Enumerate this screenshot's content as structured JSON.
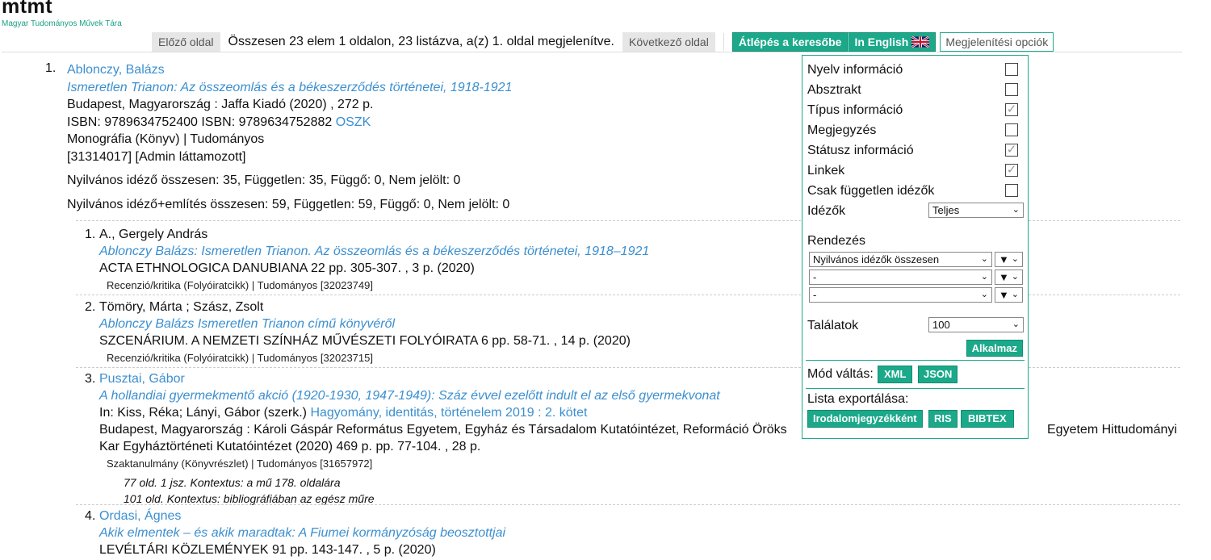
{
  "header": {
    "logo": "mtmt",
    "logo_sub": "Magyar Tudományos Művek Tára",
    "prev_label": "Előző oldal",
    "page_info": "Összesen 23 elem 1 oldalon, 23 listázva, a(z) 1. oldal megjelenítve.",
    "next_label": "Következő oldal",
    "search_label": "Átlépés a keresőbe",
    "english_label": "In English",
    "options_label": "Megjelenítési opciók"
  },
  "record": {
    "number": "1.",
    "author": "Ablonczy, Balázs",
    "title": "Ismeretlen Trianon: Az összeomlás és a békeszerződés történetei, 1918-1921",
    "publisher": "Budapest, Magyarország : Jaffa Kiadó (2020) , 272 p.",
    "isbn": "ISBN: 9789634752400 ISBN: 9789634752882",
    "isbn_link": "OSZK",
    "type": "Monográfia (Könyv) | Tudományos",
    "ids": "[31314017] [Admin láttamozott]",
    "cit_public": "Nyilvános idéző összesen: 35, Független: 35, Függő: 0, Nem jelölt: 0",
    "cit_mention": "Nyilvános idéző+említés összesen: 59, Független: 59, Függő: 0, Nem jelölt: 0"
  },
  "citations": [
    {
      "number": "1.",
      "author": "A., Gergely András",
      "title": "Ablonczy Balázs: Ismeretlen Trianon. Az összeomlás és a békeszerződés történetei, 1918–1921",
      "source": "ACTA ETHNOLOGICA DANUBIANA 22 pp. 305-307. , 3 p. (2020)",
      "meta": "Recenzió/kritika (Folyóiratcikk) | Tudományos [32023749]"
    },
    {
      "number": "2.",
      "author": "Tömöry, Márta ; Szász, Zsolt",
      "title": "Ablonczy Balázs Ismeretlen Trianon című könyvéről",
      "source": "SZCENÁRIUM. A NEMZETI SZÍNHÁZ MŰVÉSZETI FOLYÓIRATA 6 pp. 58-71. , 14 p. (2020)",
      "meta": "Recenzió/kritika (Folyóiratcikk) | Tudományos [32023715]"
    },
    {
      "number": "3.",
      "author": "Pusztai, Gábor",
      "title": "A hollandiai gyermekmentő akció (1920-1930, 1947-1949): Száz évvel ezelőtt indult el az első gyermekvonat",
      "in_prefix": "In: Kiss, Réka; Lányi, Gábor (szerk.)",
      "in_link": "Hagyomány, identitás, történelem 2019 : 2. kötet",
      "publisher_a": "Budapest, Magyarország : Károli Gáspár Református Egyetem, Egyház és Társadalom Kutatóintézet, Reformáció Öröks",
      "publisher_b": "Egyetem Hittudományi",
      "publisher_c": "Kar Egyháztörténeti Kutatóintézet (2020) 469 p. pp. 77-104. , 28 p.",
      "meta": "Szaktanulmány (Könyvrészlet) | Tudományos [31657972]",
      "ctx1": "77 old. 1 jsz. Kontextus: a mű 178. oldalára",
      "ctx2": "101 old. Kontextus: bibliográfiában az egész műre"
    },
    {
      "number": "4.",
      "author": "Ordasi, Ágnes",
      "title": "Akik elmentek – és akik maradtak: A Fiumei kormányzóság beosztottjai",
      "source": "LEVÉLTÁRI KÖZLEMÉNYEK 91 pp. 143-147. , 5 p. (2020)"
    }
  ],
  "panel": {
    "options": [
      {
        "label": "Nyelv információ",
        "checked": false
      },
      {
        "label": "Absztrakt",
        "checked": false
      },
      {
        "label": "Típus információ",
        "checked": true
      },
      {
        "label": "Megjegyzés",
        "checked": false
      },
      {
        "label": "Státusz információ",
        "checked": true
      },
      {
        "label": "Linkek",
        "checked": true
      },
      {
        "label": "Csak független idézők",
        "checked": false
      }
    ],
    "citers_label": "Idézők",
    "citers_value": "Teljes",
    "sort_label": "Rendezés",
    "sort1": "Nyilvános idézők összesen",
    "sort2": "-",
    "sort3": "-",
    "dir_glyph": "▼",
    "results_label": "Találatok",
    "results_value": "100",
    "apply_label": "Alkalmaz",
    "mode_label": "Mód váltás:",
    "xml_label": "XML",
    "json_label": "JSON",
    "export_label": "Lista exportálása:",
    "export_bib": "Irodalomjegyzékként",
    "export_ris": "RIS",
    "export_bibtex": "BIBTEX",
    "checkmark": "✓"
  }
}
